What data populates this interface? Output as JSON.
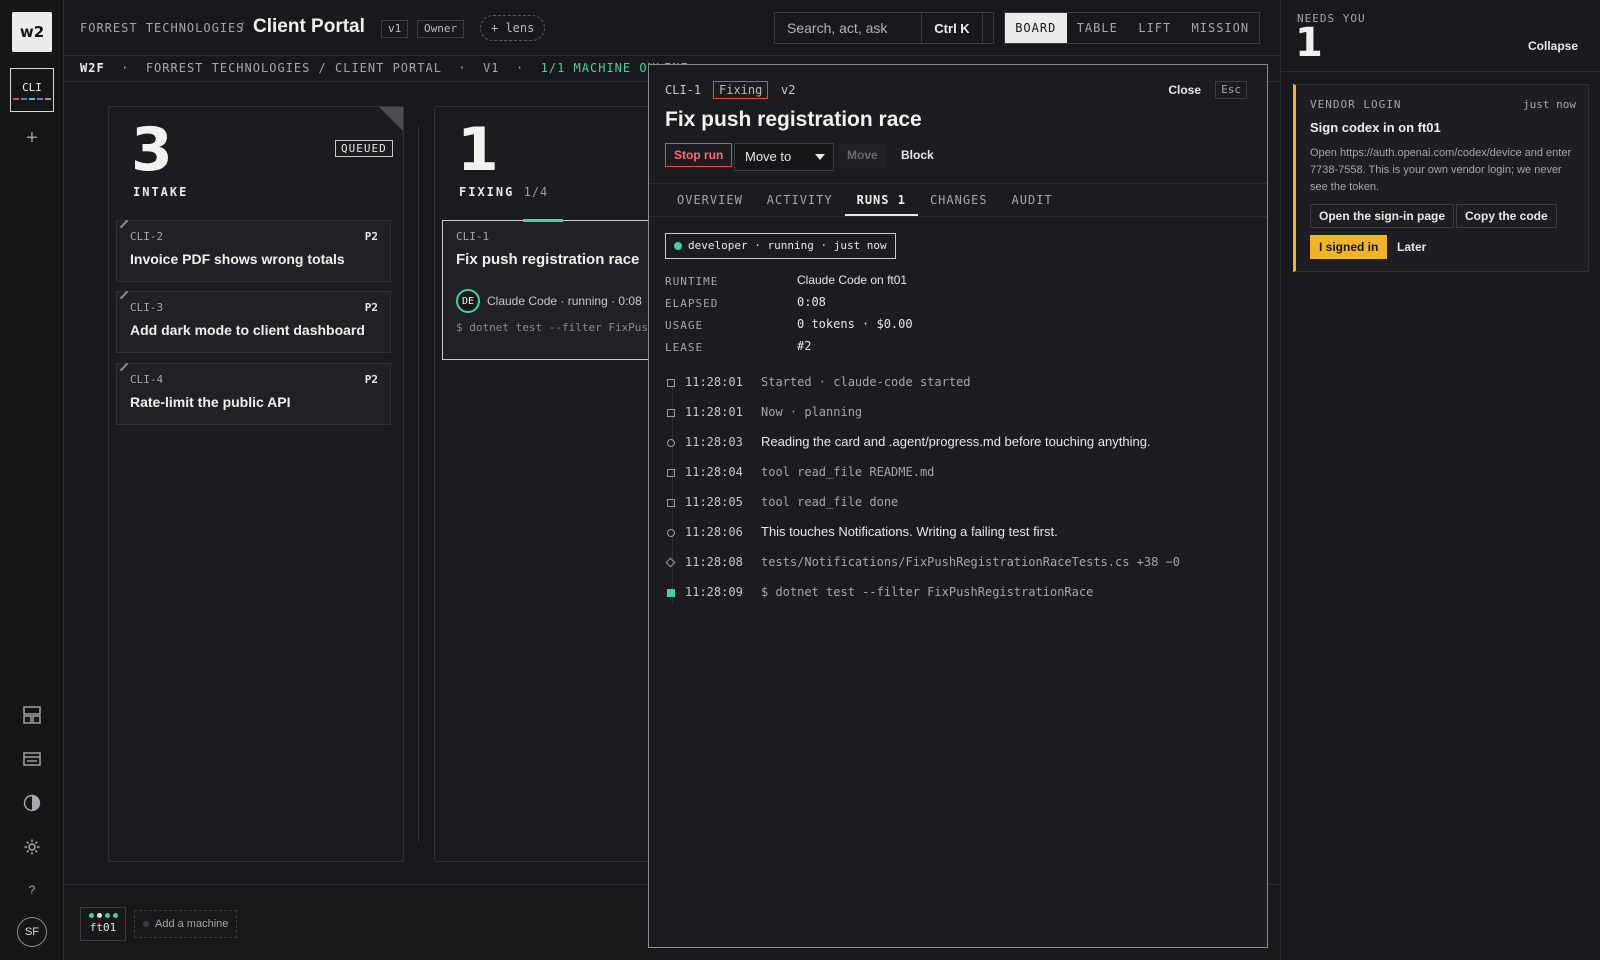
{
  "rail": {
    "logo": "w2",
    "project": "CLI",
    "project_colors": [
      "#e5484d",
      "#3b82f6",
      "#3fd4a1",
      "#a855f7",
      "#9a9c9f"
    ],
    "avatar": "SF",
    "add_glyph": "+",
    "help_glyph": "?",
    "icons": [
      "grid-icon",
      "keyboard-icon",
      "contrast-icon",
      "settings-icon"
    ]
  },
  "header": {
    "org": "FORREST TECHNOLOGIES",
    "sep": "/",
    "title": "Client Portal",
    "version": "v1",
    "role": "Owner",
    "lens": "+ lens",
    "search_placeholder": "Search, act, ask",
    "shortcut": "Ctrl K",
    "views": [
      "BOARD",
      "TABLE",
      "LIFT",
      "MISSION"
    ],
    "active_view": "BOARD"
  },
  "strip": {
    "brand": "W2F",
    "org": "FORREST TECHNOLOGIES / CLIENT PORTAL",
    "version": "V1",
    "machines": "1/1 MACHINE ONLINE",
    "dot": "·"
  },
  "columns": {
    "intake": {
      "count": "3",
      "name": "INTAKE",
      "badge": "QUEUED",
      "cards": [
        {
          "id": "CLI-2",
          "priority": "P2",
          "title": "Invoice PDF shows wrong totals"
        },
        {
          "id": "CLI-3",
          "priority": "P2",
          "title": "Add dark mode to client dashboard"
        },
        {
          "id": "CLI-4",
          "priority": "P2",
          "title": "Rate-limit the public API"
        }
      ]
    },
    "fixing": {
      "count": "1",
      "name": "FIXING",
      "progress": "1/4",
      "card": {
        "id": "CLI-1",
        "title": "Fix push registration race",
        "agent_initials": "DE",
        "status": "Claude Code · running · 0:08",
        "command": "$ dotnet test --filter FixPushRegistrationRace"
      }
    }
  },
  "footer": {
    "machine": "ft01",
    "add_machine": "Add a machine",
    "machine_dot_colors": [
      "#3fd4a1",
      "#ececea",
      "#3fd4a1",
      "#3fd4a1"
    ]
  },
  "modal": {
    "id": "CLI-1",
    "state": "Fixing",
    "version": "v2",
    "close": "Close",
    "esc": "Esc",
    "title": "Fix push registration race",
    "stop": "Stop run",
    "move_to": "Move to",
    "move": "Move",
    "block": "Block",
    "tabs": [
      "OVERVIEW",
      "ACTIVITY",
      "RUNS 1",
      "CHANGES",
      "AUDIT"
    ],
    "active_tab": "RUNS 1",
    "run_pill": "developer · running · just now",
    "details": [
      {
        "key": "RUNTIME",
        "value": "Claude Code on ft01"
      },
      {
        "key": "ELAPSED",
        "value": "0:08"
      },
      {
        "key": "USAGE",
        "value": "0 tokens · $0.00"
      },
      {
        "key": "LEASE",
        "value": "#2"
      }
    ],
    "log": [
      {
        "time": "11:28:01",
        "text": "Started · claude-code started",
        "kind": "square",
        "prose": false
      },
      {
        "time": "11:28:01",
        "text": "Now · planning",
        "kind": "square",
        "prose": false
      },
      {
        "time": "11:28:03",
        "text": "Reading the card and .agent/progress.md before touching anything.",
        "kind": "circle",
        "prose": true
      },
      {
        "time": "11:28:04",
        "text": "tool read_file README.md",
        "kind": "square",
        "prose": false
      },
      {
        "time": "11:28:05",
        "text": "tool read_file done",
        "kind": "square",
        "prose": false
      },
      {
        "time": "11:28:06",
        "text": "This touches Notifications. Writing a failing test first.",
        "kind": "circle",
        "prose": true
      },
      {
        "time": "11:28:08",
        "text": "tests/Notifications/FixPushRegistrationRaceTests.cs +38 −0",
        "kind": "diamond",
        "prose": false
      },
      {
        "time": "11:28:09",
        "text": "$ dotnet test --filter FixPushRegistrationRace",
        "kind": "fill",
        "prose": false
      }
    ]
  },
  "needs_you": {
    "label": "NEEDS YOU",
    "count": "1",
    "collapse": "Collapse",
    "card": {
      "kind": "VENDOR LOGIN",
      "time": "just now",
      "title": "Sign codex in on ft01",
      "body": "Open https://auth.openai.com/codex/device and enter 7738-7558. This is your own vendor login; we never see the token.",
      "open_btn": "Open the sign-in page",
      "copy_btn": "Copy the code",
      "signed_btn": "I signed in",
      "later_btn": "Later",
      "accent": "#f0b429"
    }
  },
  "colors": {
    "accent_green": "#3fd4a1",
    "danger": "#e5484d",
    "warning": "#f0b429"
  }
}
